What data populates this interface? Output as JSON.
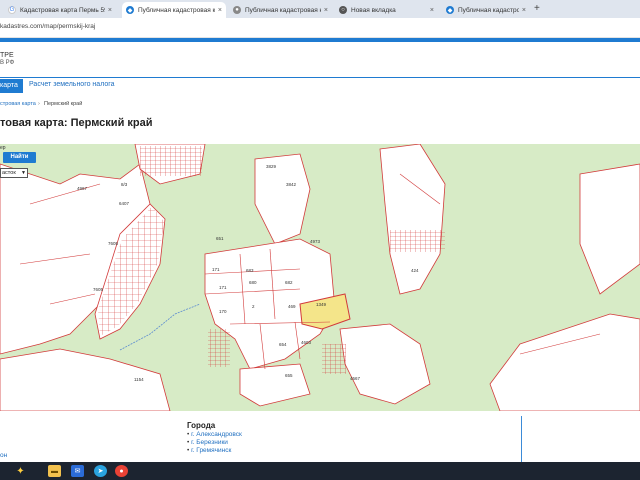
{
  "browser": {
    "tabs": [
      {
        "title": "Кадастровая карта Пермь 59...",
        "icon": "google-icon",
        "active": false
      },
      {
        "title": "Публичная кадастровая карта",
        "icon": "map-icon",
        "active": true
      },
      {
        "title": "Публичная кадастровая карта",
        "icon": "globe-icon",
        "active": false
      },
      {
        "title": "Новая вкладка",
        "icon": "newtab-icon",
        "active": false
      },
      {
        "title": "Публичная кадастровая карта",
        "icon": "map-icon",
        "active": false
      }
    ],
    "close_glyph": "×",
    "new_tab_glyph": "+",
    "url": "kadastres.com/map/permskij-kraj"
  },
  "site": {
    "logo_line1": "ТРЕ",
    "logo_line2": "В РФ",
    "nav": {
      "map": "карта",
      "tax": "Расчет земельного налога"
    },
    "breadcrumb": {
      "parent": "стровая карта",
      "sep": "›",
      "current": "Пермский край"
    },
    "title": "товая карта: Пермский край"
  },
  "map_ui": {
    "search_hint": "ер",
    "search_button": "Найти",
    "layer_select": "асток",
    "parcel_labels": [
      {
        "t": "4967"
      },
      {
        "t": "6407"
      },
      {
        "t": "7605"
      },
      {
        "t": "7605"
      },
      {
        "t": "8/3"
      },
      {
        "t": "3829"
      },
      {
        "t": "3842"
      },
      {
        "t": "171"
      },
      {
        "t": "683"
      },
      {
        "t": "171"
      },
      {
        "t": "680"
      },
      {
        "t": "682"
      },
      {
        "t": "2"
      },
      {
        "t": "469"
      },
      {
        "t": "1349"
      },
      {
        "t": "170"
      },
      {
        "t": "654"
      },
      {
        "t": "4603"
      },
      {
        "t": "655"
      },
      {
        "t": "1154"
      },
      {
        "t": "4567"
      },
      {
        "t": "424"
      },
      {
        "t": "4973"
      },
      {
        "t": "651"
      }
    ],
    "watermark": "иан"
  },
  "cities": {
    "title": "Города",
    "items": [
      "г. Александровск",
      "г. Березники",
      "г. Гремячинск"
    ]
  },
  "footer_link": "он",
  "taskbar": {
    "icons": [
      "copilot-icon",
      "file-explorer-icon",
      "mail-icon",
      "telegram-icon",
      "chrome-icon"
    ]
  },
  "colors": {
    "accent": "#1f7bd1",
    "map_bg": "#d7ebc6",
    "parcel_line": "#d23a3a",
    "highlight": "#f4e58a"
  }
}
